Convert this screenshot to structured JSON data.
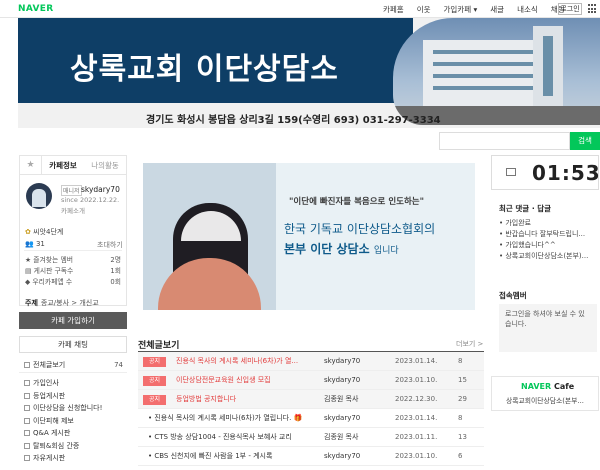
{
  "topbar": {
    "logo": "NAVER",
    "nav": [
      "카페홈",
      "이웃",
      "가입카페",
      "새글",
      "내소식",
      "채팅"
    ],
    "login": "로그인"
  },
  "banner": {
    "title": "상록교회 이단상담소",
    "address": "경기도 화성시 봉담읍 상리3길 159(수영리 693)   031-297-3334"
  },
  "search": {
    "button": "검색"
  },
  "sidebar": {
    "tabs": [
      "카페정보",
      "나의활동"
    ],
    "manager_tag": "매니저",
    "manager_name": "skydary70",
    "since": "since 2022.12.22.",
    "intro_link": "카페소개",
    "level": "씨앗4단계",
    "members": "31",
    "invite": "초대하기",
    "stats": [
      {
        "label": "즐겨찾는 멤버",
        "value": "2명"
      },
      {
        "label": "게시판 구독수",
        "value": "1회"
      },
      {
        "label": "우리카페앱 수",
        "value": "0회"
      }
    ],
    "theme_label": "주제",
    "theme_value": "종교/봉사 > 개신교",
    "join": "카페 가입하기",
    "chat": "카페 채팅",
    "all_posts": "전체글보기",
    "all_count": "74",
    "menu": [
      "가입인사",
      "등업게시판",
      "이단상담을 신청합니다!",
      "이단피해 제보",
      "Q&A 게시판",
      "탈퇴&회심 간증",
      "자유게시판"
    ]
  },
  "hero": {
    "quote": "\"이단에 빠진자를 복음으로 인도하는\"",
    "line1": "한국 기독교 이단상담소협회의",
    "line2": "본부 이단 상담소",
    "line2_suffix": "입니다"
  },
  "board": {
    "title": "전체글보기",
    "more": "더보기 >",
    "notice_label": "공지",
    "rows": [
      {
        "notice": true,
        "subject": "진용식 목사의 계시록 세미나(6차)가 열...",
        "author": "skydary70",
        "date": "2023.01.14.",
        "views": "8"
      },
      {
        "notice": true,
        "subject": "이단상담전문교육원 신입생 모집",
        "author": "skydary70",
        "date": "2023.01.10.",
        "views": "15"
      },
      {
        "notice": true,
        "subject": "등업방법 공지합니다",
        "author": "김종원 목사",
        "date": "2022.12.30.",
        "views": "29"
      },
      {
        "notice": false,
        "subject": "진용식 목사의 계시록 세미나(6차)가 열립니다. 🎁",
        "author": "skydary70",
        "date": "2023.01.14.",
        "views": "8"
      },
      {
        "notice": false,
        "subject": "CTS 방송 상담1004 - 진용식목사 보혜사 교리",
        "author": "김종원 목사",
        "date": "2023.01.11.",
        "views": "13"
      },
      {
        "notice": false,
        "subject": "CBS 신천지에 빠진 사람을 1부 - 계시록",
        "author": "skydary70",
        "date": "2023.01.10.",
        "views": "6"
      }
    ]
  },
  "right": {
    "clock": "01:53",
    "recent_title": "최근 댓글 · 답글",
    "recent": [
      "가입완료",
      "반갑습니다 잘부탁드립니...",
      "가입했습니다^^",
      "상록교회이단상담소(본부)..."
    ],
    "members_title": "접속멤버",
    "members_text": "로그인을 하셔야 보실 수 있습니다.",
    "cafe_logo_a": "NAVER",
    "cafe_logo_b": "Cafe",
    "cafe_name": "상록교회이단상담소(본부..."
  },
  "colors": {
    "naver_green": "#03c75a",
    "banner_blue": "#0e3e66",
    "notice_red": "#f36e6e"
  }
}
